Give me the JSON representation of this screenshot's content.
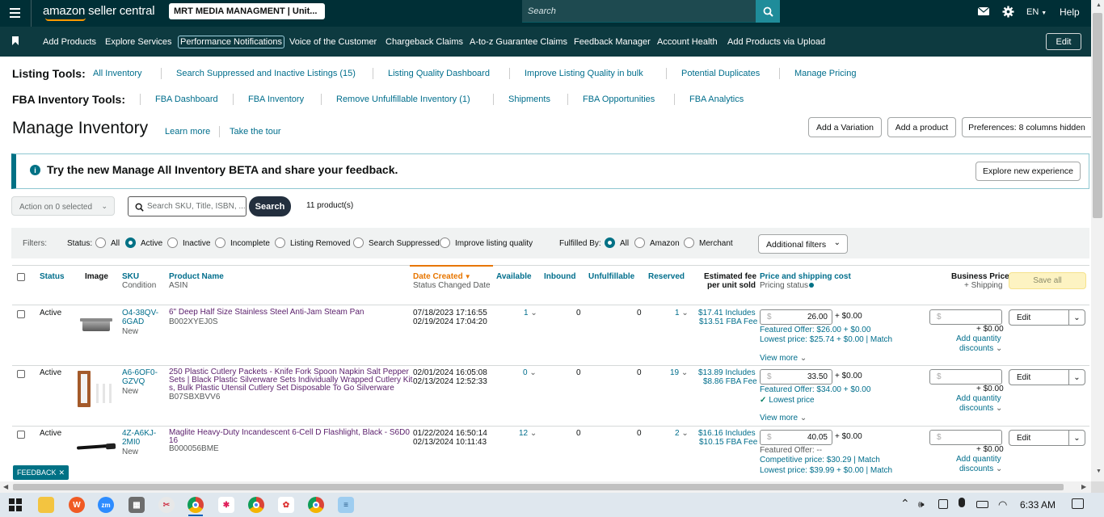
{
  "topbar": {
    "logo": "amazon seller central",
    "account": "MRT MEDIA MANAGMENT | Unit...",
    "search_placeholder": "Search",
    "language": "EN",
    "help": "Help"
  },
  "nav": {
    "items": [
      "Add Products",
      "Explore Services",
      "Performance Notifications",
      "Voice of the Customer",
      "Chargeback Claims",
      "A-to-z Guarantee Claims",
      "Feedback Manager",
      "Account Health",
      "Add Products via Upload"
    ],
    "edit": "Edit"
  },
  "listing_tools": {
    "label": "Listing Tools:",
    "links": [
      "All Inventory",
      "Search Suppressed and Inactive Listings (15)",
      "Listing Quality Dashboard",
      "Improve Listing Quality in bulk",
      "Potential Duplicates",
      "Manage Pricing"
    ]
  },
  "fba_tools": {
    "label": "FBA Inventory Tools:",
    "links": [
      "FBA Dashboard",
      "FBA Inventory",
      "Remove Unfulfillable Inventory (1)",
      "Shipments",
      "FBA Opportunities",
      "FBA Analytics"
    ]
  },
  "page": {
    "title": "Manage Inventory",
    "learn_more": "Learn more",
    "tour": "Take the tour",
    "add_variation": "Add a Variation",
    "add_product": "Add a product",
    "preferences": "Preferences: 8 columns hidden"
  },
  "banner": {
    "text": "Try the new Manage All Inventory BETA and share your feedback.",
    "button": "Explore new experience"
  },
  "actions": {
    "action_select": "Action on 0 selected",
    "search_placeholder": "Search SKU, Title, ISBN, ...",
    "search_button": "Search",
    "count": "11 product(s)"
  },
  "filters": {
    "label": "Filters:",
    "status_label": "Status:",
    "status_options": [
      "All",
      "Active",
      "Inactive",
      "Incomplete",
      "Listing Removed",
      "Search Suppressed",
      "Improve listing quality"
    ],
    "fulfilled_label": "Fulfilled By:",
    "fulfilled_options": [
      "All",
      "Amazon",
      "Merchant"
    ],
    "additional": "Additional filters"
  },
  "table": {
    "headers": {
      "status": "Status",
      "image": "Image",
      "sku": "SKU",
      "condition": "Condition",
      "product_name": "Product Name",
      "asin": "ASIN",
      "date_created": "Date Created",
      "status_changed": "Status Changed Date",
      "available": "Available",
      "inbound": "Inbound",
      "unfulfillable": "Unfulfillable",
      "reserved": "Reserved",
      "fee1": "Estimated fee",
      "fee2": "per unit sold",
      "price": "Price and shipping cost",
      "pricing_status": "Pricing status",
      "business_price": "Business Price",
      "plus_shipping": "+ Shipping",
      "save_all": "Save all"
    },
    "rows": [
      {
        "status": "Active",
        "sku1": "O4-38QV-",
        "sku2": "6GAD",
        "condition": "New",
        "name1": "6\" Deep Half Size Stainless Steel Anti-Jam Steam Pan",
        "name2": "",
        "name3": "",
        "asin": "B002XYEJ0S",
        "date_created": "07/18/2023 17:16:55",
        "date_changed": "02/19/2024 17:04:20",
        "available": "1",
        "inbound": "0",
        "unfulfillable": "0",
        "reserved": "1",
        "fee1": "$17.41 Includes",
        "fee2": "$13.51 FBA Fee",
        "price": "26.00",
        "shipping": "+ $0.00",
        "line1": "Featured Offer: $26.00 + $0.00",
        "line2": "Lowest price: $25.74 + $0.00 | ",
        "line2_link": "Match",
        "view_more": "View more",
        "bp_ship": "+ $0.00",
        "qty_discounts": "Add quantity",
        "qty_discounts2": "discounts",
        "edit": "Edit"
      },
      {
        "status": "Active",
        "sku1": "A6-6OF0-",
        "sku2": "GZVQ",
        "condition": "New",
        "name1": "250 Plastic Cutlery Packets - Knife Fork Spoon Napkin Salt Pepper",
        "name2": "Sets | Black Plastic Silverware Sets Individually Wrapped Cutlery Kit",
        "name3": "s, Bulk Plastic Utensil Cutlery Set Disposable To Go Silverware",
        "asin": "B07SBXBVV6",
        "date_created": "02/01/2024 16:05:08",
        "date_changed": "02/13/2024 12:52:33",
        "available": "0",
        "inbound": "0",
        "unfulfillable": "0",
        "reserved": "19",
        "fee1": "$13.89 Includes",
        "fee2": "$8.86 FBA Fee",
        "price": "33.50",
        "shipping": "+ $0.00",
        "line1": "Featured Offer: $34.00 + $0.00",
        "line2": "Lowest price",
        "line2_link": "",
        "view_more": "View more",
        "bp_ship": "+ $0.00",
        "qty_discounts": "Add quantity",
        "qty_discounts2": "discounts",
        "edit": "Edit"
      },
      {
        "status": "Active",
        "sku1": "4Z-A6KJ-",
        "sku2": "2MI0",
        "condition": "New",
        "name1": "Maglite Heavy-Duty Incandescent 6-Cell D Flashlight, Black - S6D0",
        "name2": "16",
        "name3": "",
        "asin": "B000056BME",
        "date_created": "01/22/2024 16:50:14",
        "date_changed": "02/13/2024 10:11:43",
        "available": "12",
        "inbound": "0",
        "unfulfillable": "0",
        "reserved": "2",
        "fee1": "$16.16 Includes",
        "fee2": "$10.15 FBA Fee",
        "price": "40.05",
        "shipping": "+ $0.00",
        "line1": "Featured Offer: --",
        "line2": "Competitive price: $30.29 | ",
        "line2_link": "Match",
        "line3": "Lowest price: $39.99 + $0.00 | ",
        "line3_link": "Match",
        "bp_ship": "+ $0.00",
        "qty_discounts": "Add quantity",
        "qty_discounts2": "discounts",
        "edit": "Edit"
      }
    ]
  },
  "feedback": "FEEDBACK",
  "taskbar": {
    "time": "6:33 AM"
  },
  "colors": {
    "topbar": "#002f36",
    "navbar": "#0d3a40",
    "link": "#006e8c",
    "accent": "#007185",
    "sort": "#e77600"
  }
}
